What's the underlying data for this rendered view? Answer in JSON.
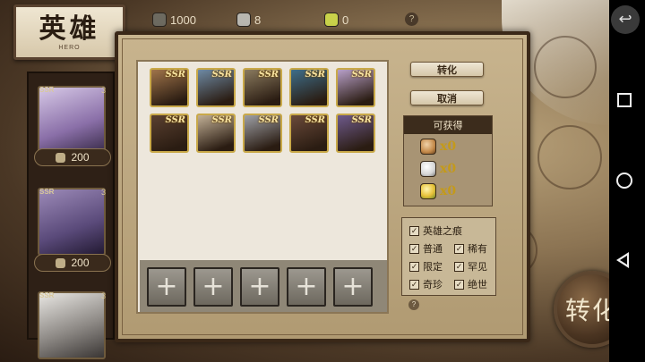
{
  "header": {
    "title": "英雄",
    "subtitle": "HERO",
    "resources": [
      {
        "icon": "coin-icon",
        "value": "1000"
      },
      {
        "icon": "crystal-icon",
        "value": "8"
      },
      {
        "icon": "gem-icon",
        "value": "0"
      }
    ],
    "help": "?"
  },
  "hero_list": [
    {
      "rarity": "SSR",
      "count": "3",
      "cost": "200"
    },
    {
      "rarity": "SSR",
      "count": "3",
      "cost": "200"
    },
    {
      "rarity": "SSR",
      "count": "3",
      "cost": ""
    }
  ],
  "panel": {
    "convert_label": "转化",
    "cancel_label": "取消",
    "obtain_title": "可获得",
    "obtain_items": [
      {
        "icon": "copper-gem-icon",
        "value": "x0",
        "color": "#c48a4a"
      },
      {
        "icon": "silver-gem-icon",
        "value": "x0",
        "color": "#d6d6d6"
      },
      {
        "icon": "gold-gem-icon",
        "value": "x0",
        "color": "#e8c23a"
      }
    ],
    "filters": {
      "header": "英雄之痕",
      "options": [
        "普通",
        "稀有",
        "限定",
        "罕见",
        "奇珍",
        "绝世"
      ]
    },
    "cards": [
      {
        "label": "SSR",
        "color": "#a0744a"
      },
      {
        "label": "SSR",
        "color": "#6e8aa4"
      },
      {
        "label": "SSR",
        "color": "#8a7a5e"
      },
      {
        "label": "SSR",
        "color": "#3e6e8a"
      },
      {
        "label": "SSR",
        "color": "#b8a0c8"
      },
      {
        "label": "SSR",
        "color": "#5a4030"
      },
      {
        "label": "SSR",
        "color": "#c2b096"
      },
      {
        "label": "SSR",
        "color": "#9ea0a6"
      },
      {
        "label": "SSR",
        "color": "#6a4a3a"
      },
      {
        "label": "SSR",
        "color": "#6e5a8c"
      }
    ],
    "empty_slot_symbol": "+",
    "help": "?"
  },
  "big_button": {
    "label": "转化"
  },
  "android_nav": {
    "top_back": "↩"
  }
}
